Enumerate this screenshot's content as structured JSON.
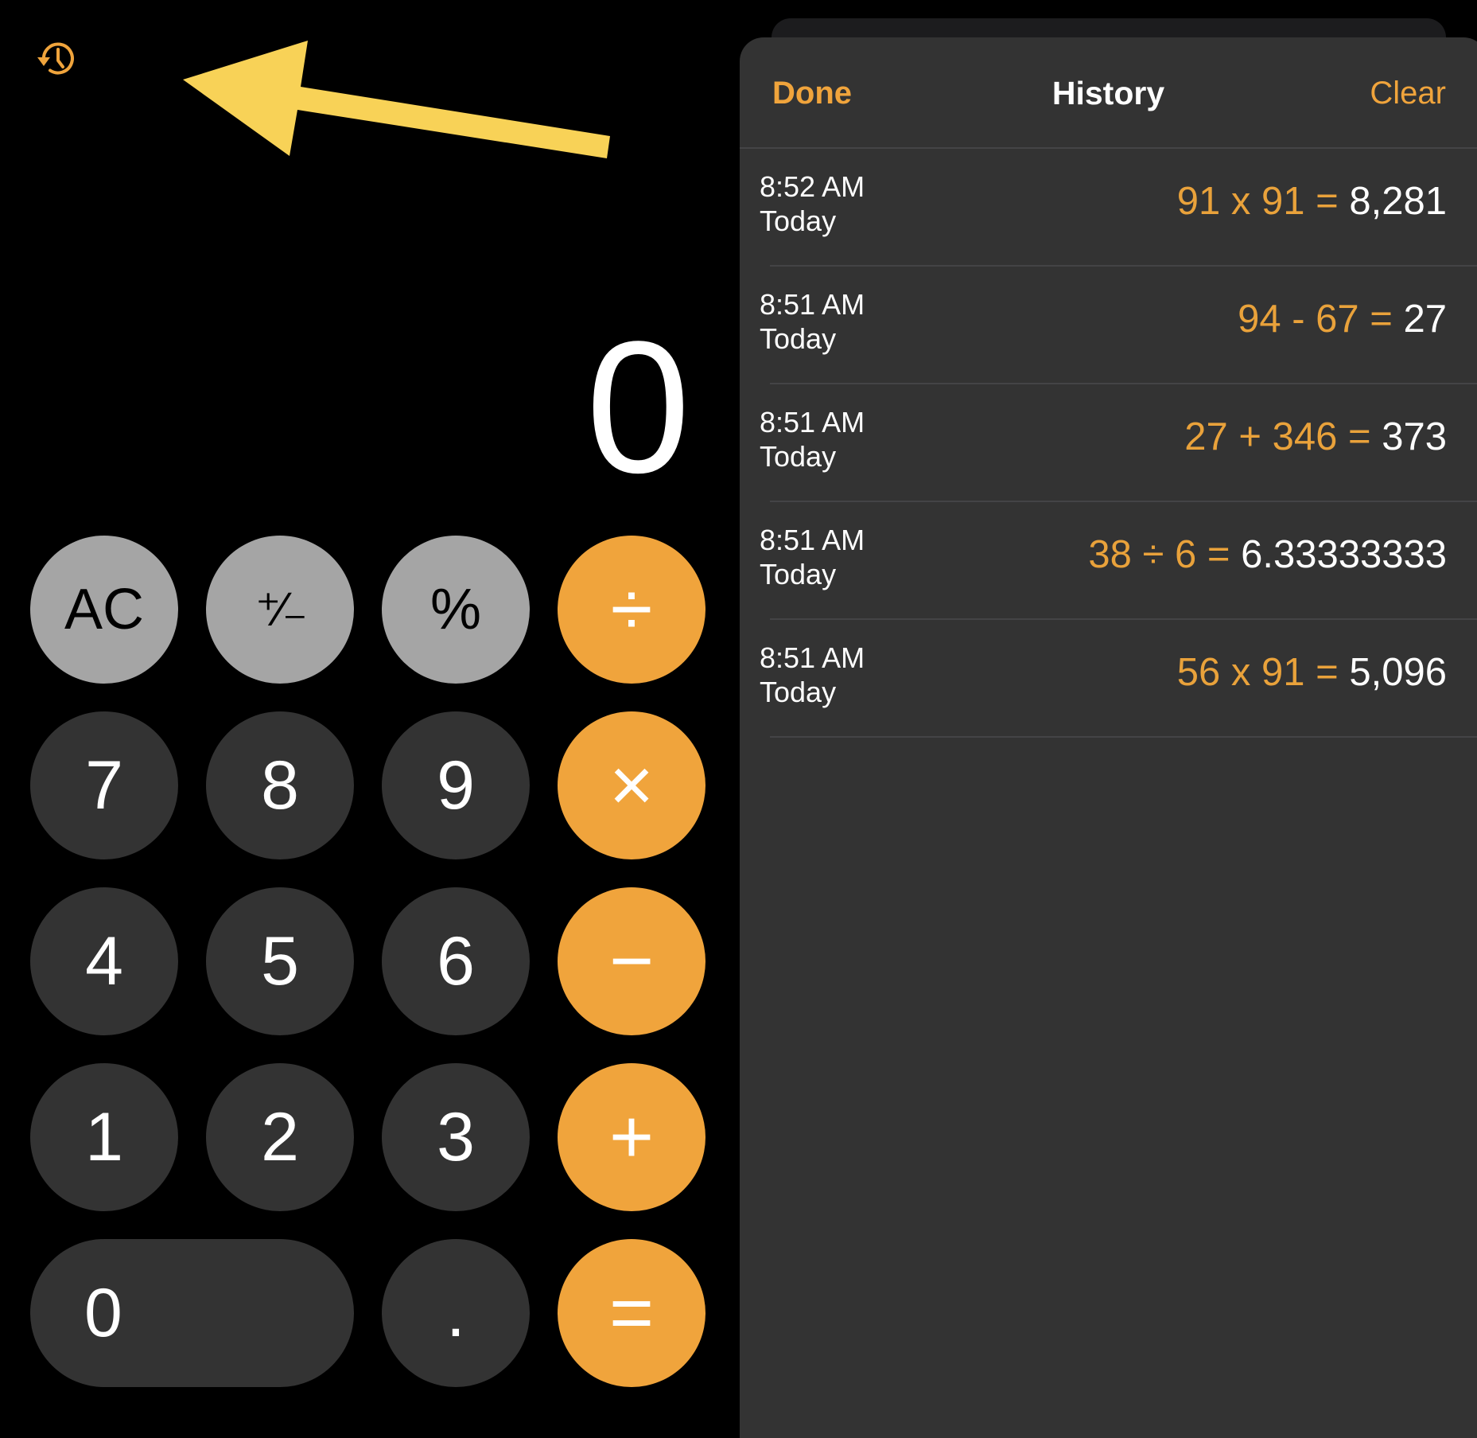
{
  "calculator": {
    "display": "0",
    "history_button": {
      "icon": "history-clock-icon",
      "color": "#f0a43c"
    },
    "annotation": {
      "type": "arrow",
      "points_to": "history-button",
      "color": "#f8d257"
    },
    "keys": [
      {
        "label": "AC",
        "kind": "fn",
        "name": "all-clear"
      },
      {
        "label": "⁺∕₋",
        "kind": "fn",
        "name": "plus-minus"
      },
      {
        "label": "%",
        "kind": "fn",
        "name": "percent"
      },
      {
        "label": "÷",
        "kind": "op",
        "name": "divide"
      },
      {
        "label": "7",
        "kind": "num",
        "name": "7"
      },
      {
        "label": "8",
        "kind": "num",
        "name": "8"
      },
      {
        "label": "9",
        "kind": "num",
        "name": "9"
      },
      {
        "label": "×",
        "kind": "op",
        "name": "multiply"
      },
      {
        "label": "4",
        "kind": "num",
        "name": "4"
      },
      {
        "label": "5",
        "kind": "num",
        "name": "5"
      },
      {
        "label": "6",
        "kind": "num",
        "name": "6"
      },
      {
        "label": "−",
        "kind": "op",
        "name": "subtract"
      },
      {
        "label": "1",
        "kind": "num",
        "name": "1"
      },
      {
        "label": "2",
        "kind": "num",
        "name": "2"
      },
      {
        "label": "3",
        "kind": "num",
        "name": "3"
      },
      {
        "label": "+",
        "kind": "op",
        "name": "add"
      },
      {
        "label": "0",
        "kind": "num",
        "name": "0"
      },
      {
        "label": ".",
        "kind": "num",
        "name": "decimal"
      },
      {
        "label": "=",
        "kind": "op",
        "name": "equals"
      }
    ]
  },
  "history": {
    "title": "History",
    "done_label": "Done",
    "clear_label": "Clear",
    "entries": [
      {
        "time": "8:52 AM",
        "day": "Today",
        "expression": "91 x 91 =",
        "result": "8,281"
      },
      {
        "time": "8:51 AM",
        "day": "Today",
        "expression": "94 - 67 =",
        "result": "27"
      },
      {
        "time": "8:51 AM",
        "day": "Today",
        "expression": "27 + 346 =",
        "result": "373"
      },
      {
        "time": "8:51 AM",
        "day": "Today",
        "expression": "38 ÷ 6 =",
        "result": "6.33333333"
      },
      {
        "time": "8:51 AM",
        "day": "Today",
        "expression": "56 x 91 =",
        "result": "5,096"
      }
    ]
  },
  "colors": {
    "accent": "#f0a43c",
    "function_key": "#a5a5a5",
    "digit_key": "#333333",
    "panel": "#333333",
    "background": "#000000"
  }
}
